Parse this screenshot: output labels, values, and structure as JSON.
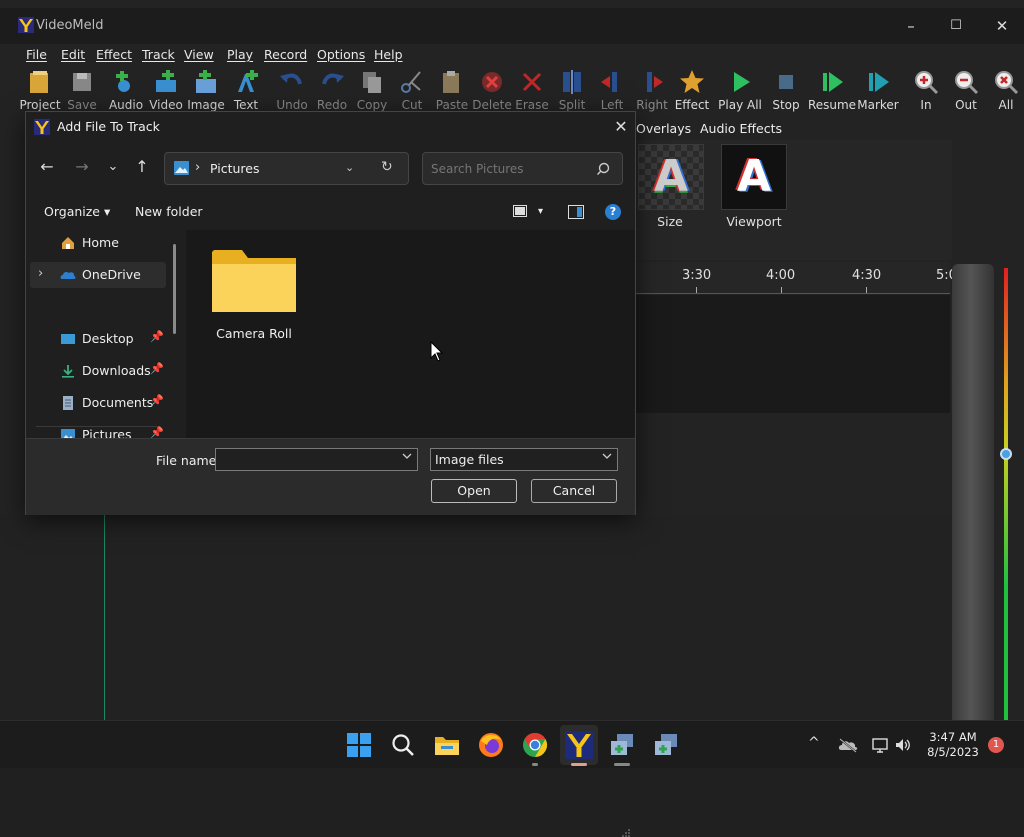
{
  "app": {
    "title": "VideoMeld",
    "minimize": "–",
    "maximize": "☐",
    "close": "✕"
  },
  "menu": [
    "File",
    "Edit",
    "Effect",
    "Track",
    "View",
    "Play",
    "Record",
    "Options",
    "Help"
  ],
  "toolbar": [
    {
      "label": "Project",
      "icon": "project-icon"
    },
    {
      "label": "Save",
      "icon": "save-icon"
    },
    {
      "label": "Audio",
      "icon": "audio-add-icon"
    },
    {
      "label": "Video",
      "icon": "video-add-icon"
    },
    {
      "label": "Image",
      "icon": "image-add-icon"
    },
    {
      "label": "Text",
      "icon": "text-add-icon"
    },
    {
      "label": "Undo",
      "icon": "undo-icon"
    },
    {
      "label": "Redo",
      "icon": "redo-icon"
    },
    {
      "label": "Copy",
      "icon": "copy-icon"
    },
    {
      "label": "Cut",
      "icon": "cut-icon"
    },
    {
      "label": "Paste",
      "icon": "paste-icon"
    },
    {
      "label": "Delete",
      "icon": "delete-icon"
    },
    {
      "label": "Erase",
      "icon": "erase-icon"
    },
    {
      "label": "Split",
      "icon": "split-icon"
    },
    {
      "label": "Left",
      "icon": "left-icon"
    },
    {
      "label": "Right",
      "icon": "right-icon"
    },
    {
      "label": "Effect",
      "icon": "effect-star-icon"
    },
    {
      "label": "Play All",
      "icon": "play-all-icon"
    },
    {
      "label": "Stop",
      "icon": "stop-icon"
    },
    {
      "label": "Resume",
      "icon": "resume-icon"
    },
    {
      "label": "Marker",
      "icon": "marker-icon"
    },
    {
      "label": "In",
      "icon": "zoom-in-icon"
    },
    {
      "label": "Out",
      "icon": "zoom-out-icon"
    },
    {
      "label": "All",
      "icon": "zoom-all-icon"
    }
  ],
  "effect_tabs": [
    "Overlays",
    "Audio Effects"
  ],
  "effect_thumbs": [
    {
      "label": "Size",
      "letter": "A"
    },
    {
      "label": "Viewport",
      "letter": "A"
    }
  ],
  "ruler": [
    "3:30",
    "4:00",
    "4:30",
    "5:0"
  ],
  "dialog": {
    "title": "Add File To Track",
    "close": "✕",
    "nav": {
      "back": "←",
      "forward": "→",
      "recent": "⌄",
      "up": "↑"
    },
    "address": {
      "sep": "›",
      "path": "Pictures",
      "dropdown": "⌄",
      "refresh": "↻"
    },
    "search_placeholder": "Search Pictures",
    "commands": {
      "organize": "Organize ▾",
      "new_folder": "New folder",
      "view_dd": "▾",
      "help": "?"
    },
    "nav_items": [
      {
        "label": "Home",
        "icon": "home-icon"
      },
      {
        "label": "OneDrive",
        "icon": "onedrive-icon",
        "expand": "›"
      },
      {
        "label": "Desktop",
        "icon": "desktop-icon",
        "pin": "📌"
      },
      {
        "label": "Downloads",
        "icon": "downloads-icon",
        "pin": "📌"
      },
      {
        "label": "Documents",
        "icon": "documents-icon",
        "pin": "📌"
      },
      {
        "label": "Pictures",
        "icon": "pictures-icon",
        "pin": "📌"
      }
    ],
    "folders": [
      {
        "label": "Camera Roll"
      }
    ],
    "filename_label": "File name:",
    "filename_value": "",
    "filetype": "Image files",
    "open": "Open",
    "cancel": "Cancel"
  },
  "taskbar": {
    "time": "3:47 AM",
    "date": "8/5/2023",
    "notifications": "1",
    "chevron": "^"
  }
}
